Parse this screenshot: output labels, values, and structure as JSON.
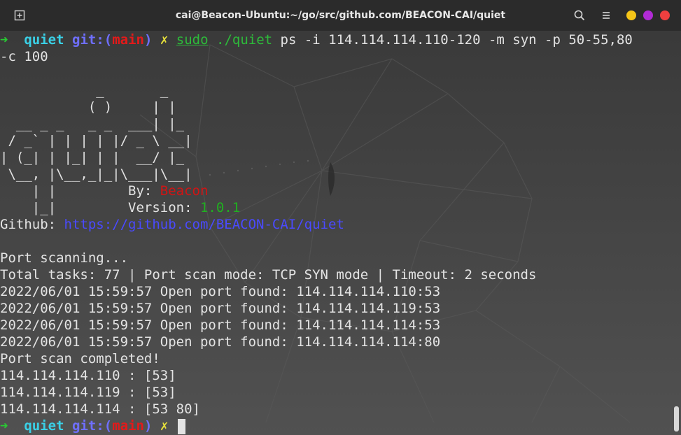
{
  "window": {
    "title": "cai@Beacon-Ubuntu:~/go/src/github.com/BEACON-CAI/quiet",
    "new_tab_icon": "new-tab-icon",
    "search_icon": "search-icon",
    "menu_icon": "hamburger-menu-icon",
    "controls": [
      {
        "name": "minimize",
        "color": "#f5c518"
      },
      {
        "name": "maximize",
        "color": "#b12bd6"
      },
      {
        "name": "close",
        "color": "#ef3f3f"
      }
    ]
  },
  "terminal": {
    "prompt": {
      "arrow": "➜",
      "dir": "quiet",
      "git_prefix": "git:(",
      "branch": "main",
      "git_suffix": ")",
      "dirty": "✗"
    },
    "command": {
      "sudo": "sudo",
      "binary": "./quiet",
      "args": "ps -i 114.114.114.110-120 -m syn -p 50-55,80",
      "wrap": "-c 100"
    },
    "banner": [
      "            _       _",
      "           ( )     | |",
      "  __ _ _   _ _  ___| |_",
      " / _` | | | | |/ _ \\ __|",
      "| (_| | |_| | |  __/ |_",
      " \\__, |\\__,_|_|\\___|\\__|",
      "    | |"
    ],
    "banner_last": "    |_|",
    "by_label": "By: ",
    "by_value": "Beacon",
    "version_label": "Version: ",
    "version_value": "1.0.1",
    "github_label": "Github: ",
    "github_url": "https://github.com/BEACON-CAI/quiet",
    "output": [
      "Port scanning...",
      "Total tasks: 77 | Port scan mode: TCP SYN mode | Timeout: 2 seconds",
      "2022/06/01 15:59:57 Open port found: 114.114.114.110:53",
      "2022/06/01 15:59:57 Open port found: 114.114.114.119:53",
      "2022/06/01 15:59:57 Open port found: 114.114.114.114:53",
      "2022/06/01 15:59:57 Open port found: 114.114.114.114:80",
      "Port scan completed!",
      "114.114.114.110 : [53]",
      "114.114.114.119 : [53]",
      "114.114.114.114 : [53 80]"
    ]
  }
}
